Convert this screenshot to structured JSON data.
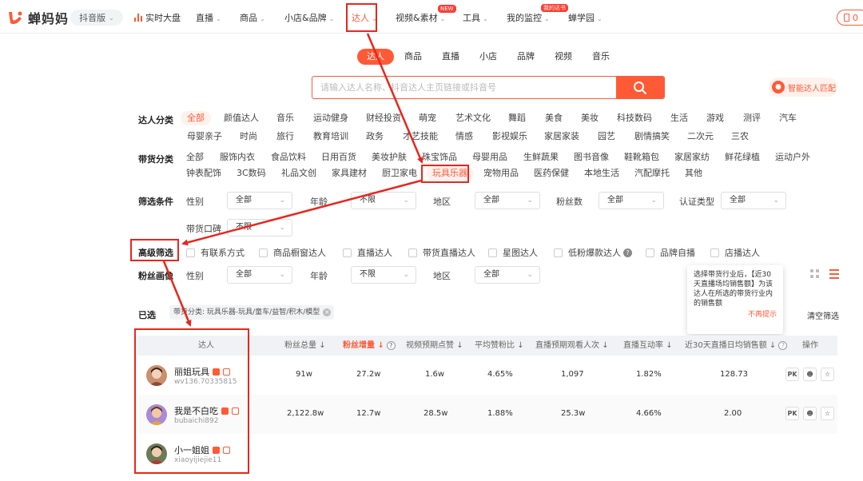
{
  "header": {
    "logo_text": "蝉妈妈",
    "version": "抖音版",
    "nav": [
      {
        "label": "实时大盘"
      },
      {
        "label": "直播"
      },
      {
        "label": "商品"
      },
      {
        "label": "小店&品牌"
      },
      {
        "label": "达人"
      },
      {
        "label": "视频&素材"
      },
      {
        "label": "工具"
      },
      {
        "label": "我的监控"
      },
      {
        "label": "蝉学园"
      }
    ],
    "badge_new": "NEW",
    "badge_mine": "我的达书",
    "right_button": "0"
  },
  "type_tabs": [
    "达人",
    "商品",
    "直播",
    "小店",
    "品牌",
    "视频",
    "音乐"
  ],
  "search": {
    "placeholder": "请输入达人名称、抖音达人主页链接或抖音号",
    "smart_match": "智能达人匹配"
  },
  "filters": {
    "category": {
      "label": "达人分类",
      "row1": [
        "全部",
        "颜值达人",
        "音乐",
        "运动健身",
        "财经投资",
        "萌宠",
        "艺术文化",
        "舞蹈",
        "美食",
        "美妆",
        "科技数码",
        "生活",
        "游戏",
        "测评",
        "汽车"
      ],
      "row2": [
        "母婴亲子",
        "时尚",
        "旅行",
        "教育培训",
        "政务",
        "才艺技能",
        "情感",
        "影视娱乐",
        "家居家装",
        "园艺",
        "剧情搞笑",
        "二次元",
        "三农"
      ]
    },
    "goods": {
      "label": "带货分类",
      "row1": [
        "全部",
        "服饰内衣",
        "食品饮料",
        "日用百货",
        "美妆护肤",
        "珠宝饰品",
        "母婴用品",
        "生鲜蔬果",
        "图书音像",
        "鞋靴箱包",
        "家居家纺",
        "鲜花绿植",
        "运动户外"
      ],
      "row2": [
        "钟表配饰",
        "3C数码",
        "礼品文创",
        "家具建材",
        "厨卫家电",
        "玩具乐器",
        "宠物用品",
        "医药保健",
        "本地生活",
        "汽配摩托",
        "其他"
      ]
    },
    "conditions": {
      "label": "筛选条件",
      "gender_label": "性别",
      "gender": "全部",
      "age_label": "年龄",
      "age": "不限",
      "region_label": "地区",
      "region": "全部",
      "fans_label": "粉丝数",
      "fans": "全部",
      "cert_label": "认证类型",
      "cert": "全部",
      "reputation_label": "带货口碑",
      "reputation": "不限"
    },
    "advanced": {
      "label": "高级筛选",
      "options": [
        "有联系方式",
        "商品橱窗达人",
        "直播达人",
        "带货直播达人",
        "星图达人",
        "低粉爆款达人",
        "品牌自播",
        "店播达人"
      ]
    },
    "portrait": {
      "label": "粉丝画像",
      "gender_label": "性别",
      "gender": "全部",
      "age_label": "年龄",
      "age": "不限",
      "region_label": "地区",
      "region": "全部"
    }
  },
  "tooltip": {
    "text": "选择带货行业后，【近30天直播场均销售额】为该达人在所选的带货行业内的销售额",
    "dismiss": "不再提示"
  },
  "selected": {
    "label": "已选",
    "tag": "带货分类: 玩具乐器-玩具/童车/益智/积木/模型",
    "clear": "清空筛选"
  },
  "table": {
    "headers": [
      "达人",
      "粉丝总量",
      "粉丝增量",
      "视频预期点赞",
      "平均赞粉比",
      "直播预期观看人次",
      "直播互动率",
      "近30天直播日均销售额",
      "操作"
    ],
    "rows": [
      {
        "name": "丽姐玩具",
        "account": "wv136.70335815",
        "fans": "91w",
        "growth": "27.2w",
        "likes": "1.6w",
        "ratio": "4.65%",
        "views": "1,097",
        "interact": "1.82%",
        "sales": "128.73",
        "avatar_color": "#c98f6e"
      },
      {
        "name": "我是不白吃",
        "account": "bubaichi892",
        "fans": "2,122.8w",
        "growth": "12.7w",
        "likes": "28.5w",
        "ratio": "1.88%",
        "views": "25.3w",
        "interact": "4.66%",
        "sales": "2.00",
        "avatar_color": "#a88ad6"
      },
      {
        "name": "小一姐姐",
        "account": "xiaoyijiejie11",
        "fans": "",
        "growth": "",
        "likes": "",
        "ratio": "",
        "views": "",
        "interact": "",
        "sales": "",
        "avatar_color": "#6b7c55"
      }
    ],
    "op_pk": "PK"
  },
  "colors": {
    "accent": "#ff5a36",
    "annotation": "#e8261d"
  }
}
